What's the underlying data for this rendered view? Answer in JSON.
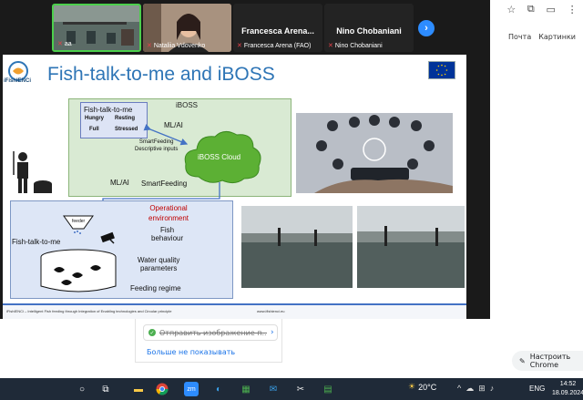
{
  "browser": {
    "links": [
      "Почта",
      "Картинки"
    ],
    "customize_label": "Настроить Chrome"
  },
  "zoom": {
    "participants": [
      {
        "name": "aa",
        "muted": true
      },
      {
        "name": "Nataliia Vdovenko",
        "muted": true
      },
      {
        "name": "Francesca Arena (FAO)",
        "display_name": "Francesca Arena...",
        "muted": true
      },
      {
        "name": "Nino Chobaniani",
        "display_name": "Nino Chobaniani",
        "muted": true
      }
    ],
    "next_label": "›"
  },
  "slide": {
    "logo_text": "iFishIENCi",
    "title": "Fish-talk-to-me and iBOSS",
    "iboss_label": "iBOSS",
    "fish_box": {
      "title": "Fish-talk-to-me",
      "states": [
        "Hungry",
        "Resting",
        "Full",
        "Stressed"
      ]
    },
    "cloud_label": "iBOSS Cloud",
    "mlai_top": "ML/AI",
    "smartfeeding_desc": [
      "SmartFeeding",
      "Descriptive inputs"
    ],
    "mlai_bottom": "ML/AI",
    "smartfeeding_bottom": "SmartFeeding",
    "operational_env": [
      "Operational",
      "environment"
    ],
    "env_items": [
      [
        "Fish",
        "behaviour"
      ],
      [
        "Water quality",
        "parameters"
      ],
      [
        "Feeding regime"
      ]
    ],
    "fish_talk_label": "Fish-talk-to-me",
    "feeder_label": "feeder",
    "footer_text": "iFishIENCi – Intelligent Fish feeding through Integration of Enabling technologies and Circular principle",
    "footer_url": "www.ifishienci.eu"
  },
  "notification": {
    "text": "Отправить изображение п...",
    "dismiss": "Больше не показывать"
  },
  "taskbar": {
    "weather": "20°C",
    "lang": "ENG",
    "time": "14:52",
    "date": "18.09.2024"
  },
  "colors": {
    "zoom_bg": "#1a1a1a",
    "active_speaker": "#4ccf4c",
    "title_blue": "#2e75b6",
    "iboss_green": "#d9ead3",
    "env_blue": "#dde6f6",
    "operational_red": "#c00000",
    "taskbar": "#1f2a38"
  }
}
